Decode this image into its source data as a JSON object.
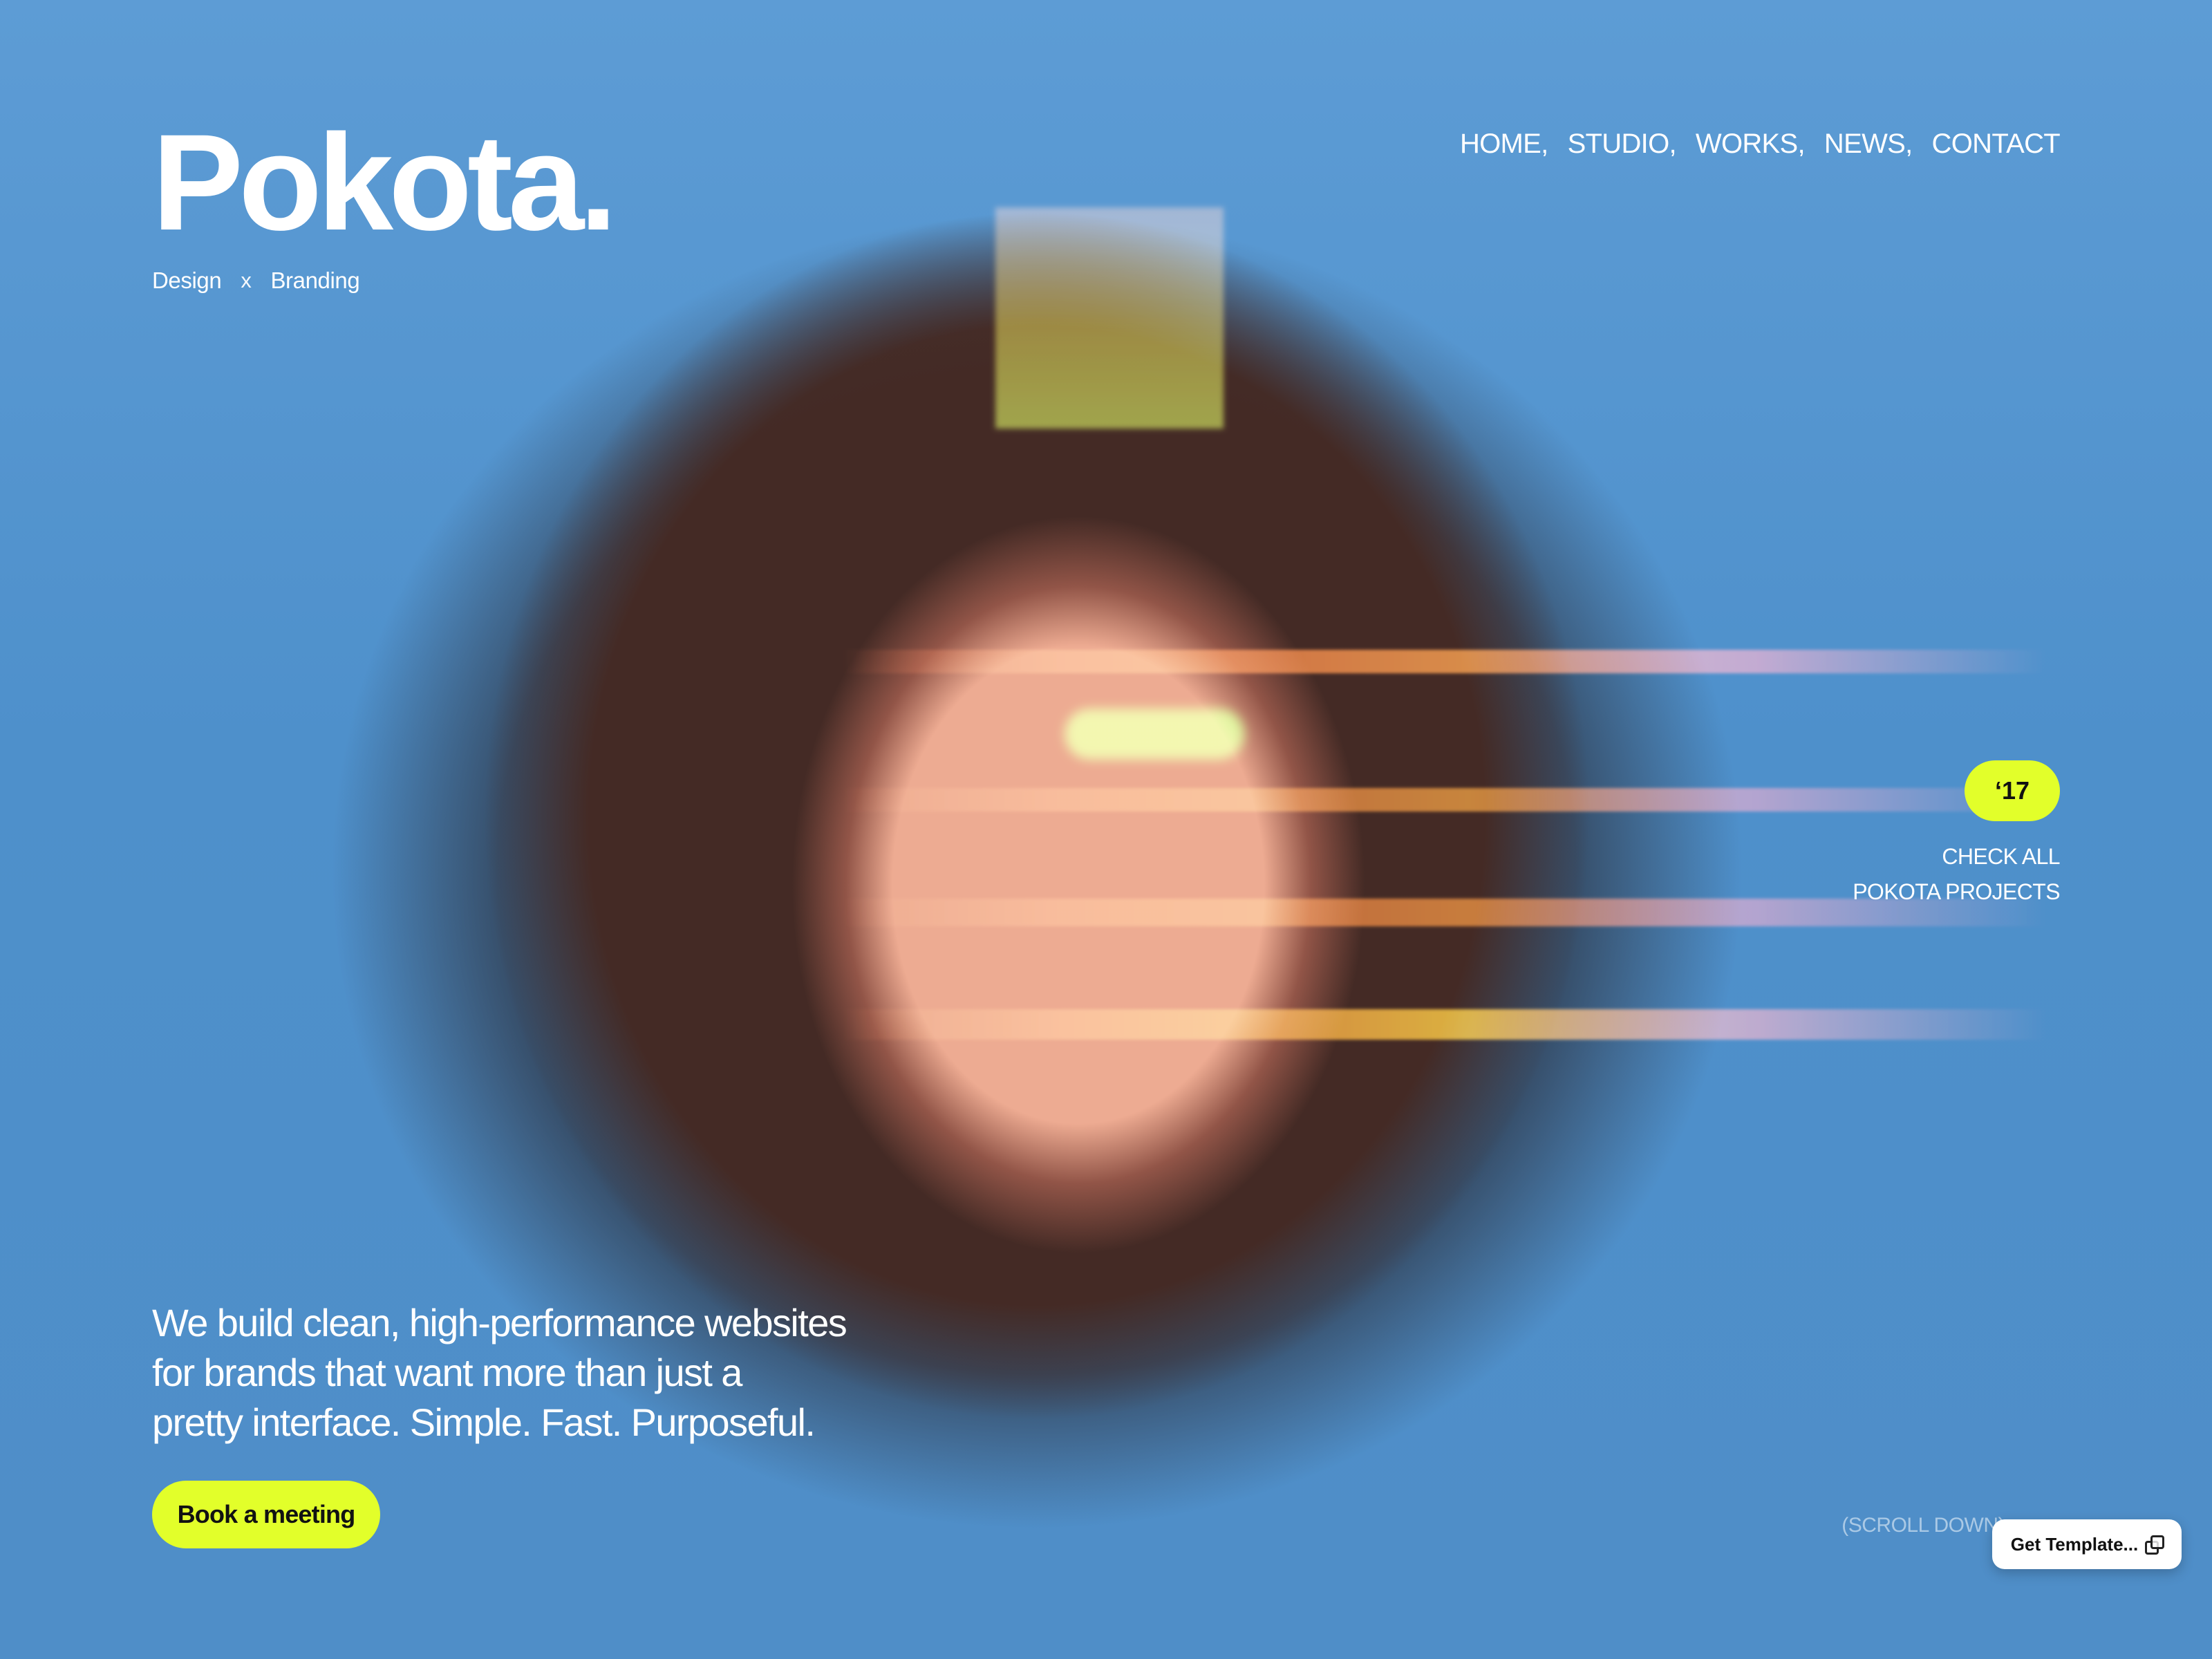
{
  "brand": {
    "name": "Pokota.",
    "tagline_left": "Design",
    "tagline_sep": "x",
    "tagline_right": "Branding"
  },
  "nav": {
    "items": [
      "HOME,",
      "STUDIO,",
      "WORKS,",
      "NEWS,",
      "CONTACT"
    ]
  },
  "project_callout": {
    "badge": "‘17",
    "line_1": "CHECK ALL",
    "line_2": "POKOTA PROJECTS"
  },
  "hero": {
    "line_1": "We build clean, high-performance websites",
    "line_2": "for brands that want more than just a",
    "line_3": "pretty interface. Simple. Fast. Purposeful.",
    "cta_label": "Book a meeting",
    "scroll_label": "(SCROLL DOWN)"
  },
  "floating_button": {
    "label": "Get Template..."
  },
  "colors": {
    "background_blue": "#4f8fc8",
    "accent_lime": "#e2ff2a",
    "text_white": "#ffffff",
    "button_dark": "#121212"
  },
  "icons": {
    "template": "template-copy-icon"
  }
}
